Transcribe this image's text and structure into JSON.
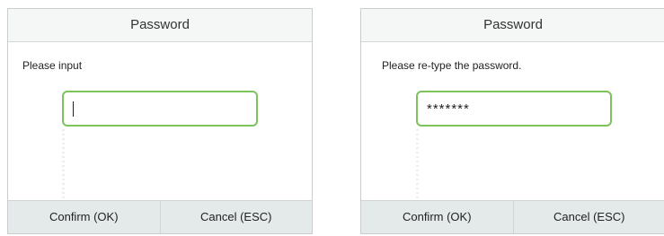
{
  "dialogs": [
    {
      "title": "Password",
      "prompt": "Please input",
      "field_value": "",
      "confirm_label": "Confirm (OK)",
      "cancel_label": "Cancel (ESC)"
    },
    {
      "title": "Password",
      "prompt": "Please re-type the password.",
      "field_value": "*******",
      "confirm_label": "Confirm (OK)",
      "cancel_label": "Cancel (ESC)"
    }
  ],
  "colors": {
    "field_border": "#7cc35a",
    "title_bar": "#f5f6f6",
    "button_bar": "#e4e9ea"
  }
}
